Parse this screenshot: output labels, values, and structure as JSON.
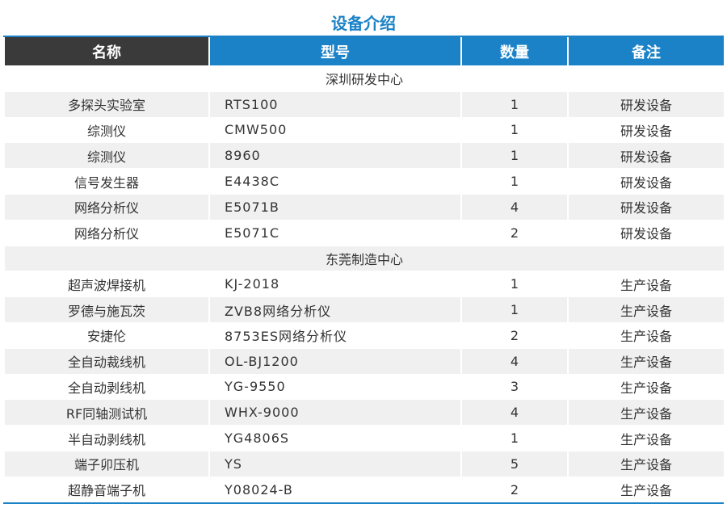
{
  "title": "设备介绍",
  "headers": {
    "name": "名称",
    "model": "型号",
    "qty": "数量",
    "note": "备注"
  },
  "sections": [
    {
      "label": "深圳研发中心",
      "rows": [
        {
          "name": "多探头实验室",
          "model": "RTS100",
          "qty": "1",
          "note": "研发设备"
        },
        {
          "name": "综测仪",
          "model": "CMW500",
          "qty": "1",
          "note": "研发设备"
        },
        {
          "name": "综测仪",
          "model": "8960",
          "qty": "1",
          "note": "研发设备"
        },
        {
          "name": "信号发生器",
          "model": "E4438C",
          "qty": "1",
          "note": "研发设备"
        },
        {
          "name": "网络分析仪",
          "model": "E5071B",
          "qty": "4",
          "note": "研发设备"
        },
        {
          "name": "网络分析仪",
          "model": "E5071C",
          "qty": "2",
          "note": "研发设备"
        }
      ]
    },
    {
      "label": "东莞制造中心",
      "rows": [
        {
          "name": "超声波焊接机",
          "model": "KJ-2018",
          "qty": "1",
          "note": "生产设备"
        },
        {
          "name": "罗德与施瓦茨",
          "model": "ZVB8网络分析仪",
          "qty": "1",
          "note": "生产设备"
        },
        {
          "name": "安捷伦",
          "model": "8753ES网络分析仪",
          "qty": "2",
          "note": "生产设备"
        },
        {
          "name": "全自动裁线机",
          "model": "OL-BJ1200",
          "qty": "4",
          "note": "生产设备"
        },
        {
          "name": "全自动剥线机",
          "model": "YG-9550",
          "qty": "3",
          "note": "生产设备"
        },
        {
          "name": "RF同轴测试机",
          "model": "WHX-9000",
          "qty": "4",
          "note": "生产设备"
        },
        {
          "name": "半自动剥线机",
          "model": "YG4806S",
          "qty": "1",
          "note": "生产设备"
        },
        {
          "name": "端子卯压机",
          "model": "YS",
          "qty": "5",
          "note": "生产设备"
        },
        {
          "name": "超静音端子机",
          "model": "Y08024-B",
          "qty": "2",
          "note": "生产设备"
        }
      ]
    }
  ]
}
